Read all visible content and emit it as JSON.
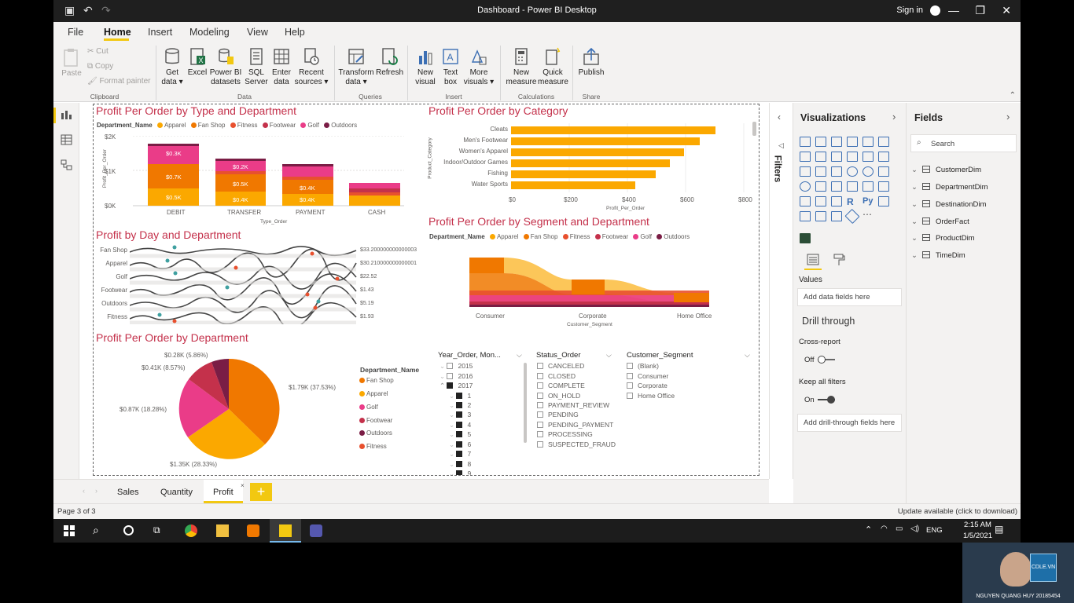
{
  "window": {
    "title": "Dashboard - Power BI Desktop",
    "signin": "Sign in"
  },
  "menu": {
    "file": "File",
    "home": "Home",
    "insert": "Insert",
    "modeling": "Modeling",
    "view": "View",
    "help": "Help"
  },
  "ribbon": {
    "clipboard": {
      "paste": "Paste",
      "cut": "Cut",
      "copy": "Copy",
      "format_painter": "Format painter",
      "group": "Clipboard"
    },
    "data": {
      "get_data": "Get data",
      "excel": "Excel",
      "pbi": "Power BI datasets",
      "sql": "SQL Server",
      "enter": "Enter data",
      "recent": "Recent sources",
      "group": "Data"
    },
    "queries": {
      "transform": "Transform data",
      "refresh": "Refresh",
      "group": "Queries"
    },
    "insert": {
      "new_visual": "New visual",
      "text_box": "Text box",
      "more_visuals": "More visuals",
      "group": "Insert"
    },
    "calc": {
      "new_measure": "New measure",
      "quick_measure": "Quick measure",
      "group": "Calculations"
    },
    "share": {
      "publish": "Publish",
      "group": "Share"
    }
  },
  "visuals": {
    "v1": {
      "title": "Profit Per Order by Type and Department",
      "legend_title": "Department_Name",
      "legend": [
        "Apparel",
        "Fan Shop",
        "Fitness",
        "Footwear",
        "Golf",
        "Outdoors"
      ],
      "yticks": [
        "$2K",
        "$1K",
        "$0K"
      ],
      "ylabel": "Profit_Per_Order",
      "xlabel": "Type_Order",
      "categories": [
        "DEBIT",
        "TRANSFER",
        "PAYMENT",
        "CASH"
      ],
      "labels": [
        "$0.3K",
        "$0.7K",
        "$0.5K",
        "$0.2K",
        "$0.5K",
        "$0.4K",
        "$0.4K",
        "$0.4K",
        "$0.4K"
      ]
    },
    "v2": {
      "title": "Profit Per Order by Category",
      "ylabel": "Product_Category",
      "xlabel": "Profit_Per_Order",
      "categories": [
        "Cleats",
        "Men's Footwear",
        "Women's Apparel",
        "Indoor/Outdoor Games",
        "Fishing",
        "Water Sports"
      ],
      "xticks": [
        "$0",
        "$200",
        "$400",
        "$600",
        "$800"
      ]
    },
    "v3": {
      "title": "Profit by Day and Department",
      "rows": [
        {
          "name": "Fan Shop",
          "value": "$33.200000000000003"
        },
        {
          "name": "Apparel",
          "value": "$30.210000000000001"
        },
        {
          "name": "Golf",
          "value": "$22.52"
        },
        {
          "name": "Footwear",
          "value": "$1.43"
        },
        {
          "name": "Outdoors",
          "value": "$5.19"
        },
        {
          "name": "Fitness",
          "value": "$1.93"
        }
      ]
    },
    "v4": {
      "title": "Profit Per Order by Segment and Department",
      "legend_title": "Department_Name",
      "legend": [
        "Apparel",
        "Fan Shop",
        "Fitness",
        "Footwear",
        "Golf",
        "Outdoors"
      ],
      "categories": [
        "Consumer",
        "Corporate",
        "Home Office"
      ],
      "xlabel": "Customer_Segment"
    },
    "v5": {
      "title": "Profit Per Order by Department",
      "labels": [
        "$0.28K (5.86%)",
        "$0.41K (8.57%)",
        "$0.87K (18.28%)",
        "$1.35K (28.33%)",
        "$1.79K (37.53%)"
      ],
      "legend_title": "Department_Name",
      "legend": [
        "Fan Shop",
        "Apparel",
        "Golf",
        "Footwear",
        "Outdoors",
        "Fitness"
      ]
    },
    "slicer1": {
      "title": "Year_Order, Mon...",
      "items": [
        "2015",
        "2016",
        "2017",
        "1",
        "2",
        "3",
        "4",
        "5",
        "6",
        "7",
        "8",
        "9"
      ]
    },
    "slicer2": {
      "title": "Status_Order",
      "items": [
        "CANCELED",
        "CLOSED",
        "COMPLETE",
        "ON_HOLD",
        "PAYMENT_REVIEW",
        "PENDING",
        "PENDING_PAYMENT",
        "PROCESSING",
        "SUSPECTED_FRAUD"
      ]
    },
    "slicer3": {
      "title": "Customer_Segment",
      "items": [
        "(Blank)",
        "Consumer",
        "Corporate",
        "Home Office"
      ]
    }
  },
  "chart_data": [
    {
      "type": "bar",
      "title": "Profit Per Order by Type and Department",
      "categories": [
        "DEBIT",
        "TRANSFER",
        "PAYMENT",
        "CASH"
      ],
      "series": [
        {
          "name": "Apparel",
          "values": [
            500,
            400,
            350,
            300
          ]
        },
        {
          "name": "Fan Shop",
          "values": [
            700,
            500,
            400,
            0
          ]
        },
        {
          "name": "Fitness",
          "values": [
            0,
            100,
            100,
            150
          ]
        },
        {
          "name": "Footwear",
          "values": [
            0,
            0,
            0,
            150
          ]
        },
        {
          "name": "Golf",
          "values": [
            300,
            200,
            0,
            0
          ]
        },
        {
          "name": "Outdoors",
          "values": [
            50,
            50,
            50,
            0
          ]
        }
      ],
      "ylim": [
        0,
        2000
      ]
    },
    {
      "type": "bar",
      "title": "Profit Per Order by Category",
      "categories": [
        "Cleats",
        "Men's Footwear",
        "Women's Apparel",
        "Indoor/Outdoor Games",
        "Fishing",
        "Water Sports"
      ],
      "values": [
        700,
        650,
        595,
        550,
        500,
        430
      ],
      "xlim": [
        0,
        800
      ]
    },
    {
      "type": "pie",
      "title": "Profit Per Order by Department",
      "slices": [
        {
          "name": "Fan Shop",
          "value": 1790
        },
        {
          "name": "Apparel",
          "value": 1350
        },
        {
          "name": "Golf",
          "value": 870
        },
        {
          "name": "Footwear",
          "value": 410
        },
        {
          "name": "Outdoors",
          "value": 280
        }
      ]
    }
  ],
  "right": {
    "filters": "Filters",
    "visualizations": "Visualizations",
    "fields": "Fields",
    "search": "Search",
    "values": "Values",
    "add_fields": "Add data fields here",
    "drill": "Drill through",
    "cross": "Cross-report",
    "off": "Off",
    "keep": "Keep all filters",
    "on": "On",
    "add_drill": "Add drill-through fields here",
    "tables": [
      "CustomerDim",
      "DepartmentDim",
      "DestinationDim",
      "OrderFact",
      "ProductDim",
      "TimeDim"
    ]
  },
  "tabs": [
    "Sales",
    "Quantity",
    "Profit"
  ],
  "status": {
    "page": "Page 3 of 3",
    "update": "Update available (click to download)"
  },
  "taskbar": {
    "lang": "ENG",
    "time": "2:15 AM",
    "date": "1/5/2021"
  },
  "webcam": {
    "name": "NGUYEN QUANG HUY 20185454",
    "logo": "CDLE.VN"
  },
  "colors": {
    "accent": "#f2c811",
    "title": "#c4314b",
    "apparel": "#fba800",
    "fanshop": "#f07800",
    "fitness": "#e8502e",
    "footwear": "#c4314b",
    "golf": "#ea3c88",
    "outdoors": "#7a1d45"
  }
}
